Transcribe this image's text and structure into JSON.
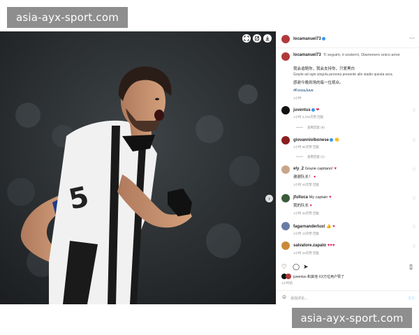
{
  "watermark": {
    "top": "asia-ayx-sport.com",
    "bottom": "asia-ayx-sport.com"
  },
  "post": {
    "author": "locamanuel73",
    "caption_user": "locamanuel73",
    "caption_line1": "Ti seguirò, ti sosterrò, Diamonero unico amor",
    "caption_line2": "我会追随你，我会支持你，只爱黑白",
    "caption_line3": "Grazie ad ogni singola persona presente allo stadio questa sera.",
    "caption_line4": "感谢今晚到场的每一位观众。",
    "caption_line5": "#ForzaJuve",
    "caption_time": "1小时"
  },
  "comments": [
    {
      "user": "juventus",
      "text": "",
      "time": "1小时",
      "likes": "2,232次赞",
      "reply": "回复",
      "view_replies": "查看回复 (9)"
    },
    {
      "user": "giovanniolbonese",
      "text": "",
      "time": "1小时",
      "likes": "56次赞",
      "reply": "回复",
      "view_replies": "查看回复 (1)"
    },
    {
      "user": "ely_2",
      "text": "Grazie capitano!",
      "text2": "谢谢队长！",
      "time": "1小时",
      "likes": "43次赞",
      "reply": "回复"
    },
    {
      "user": "jfulluca",
      "text": "My captain",
      "text2": "我的队长",
      "time": "1小时",
      "likes": "33次赞",
      "reply": "回复"
    },
    {
      "user": "fagarnanderlust",
      "text": "",
      "time": "1小时",
      "likes": "13次赞",
      "reply": "回复"
    },
    {
      "user": "salvatore.zapato",
      "text": "",
      "time": "1小时",
      "likes": "43次赞",
      "reply": "回复"
    }
  ],
  "likes_line": "juventus 和其他 XX万位用户赞了",
  "post_time": "1小时前",
  "composer": {
    "placeholder": "添加评论...",
    "post_label": "发布"
  },
  "colors": {
    "accent": "#3897f0",
    "heart": "#e0245e"
  },
  "icons": [
    "expand-icon",
    "share-icon",
    "download-icon",
    "more-icon",
    "heart-icon",
    "comment-icon",
    "send-icon",
    "bookmark-icon",
    "emoji-icon",
    "chevron-right-icon"
  ]
}
